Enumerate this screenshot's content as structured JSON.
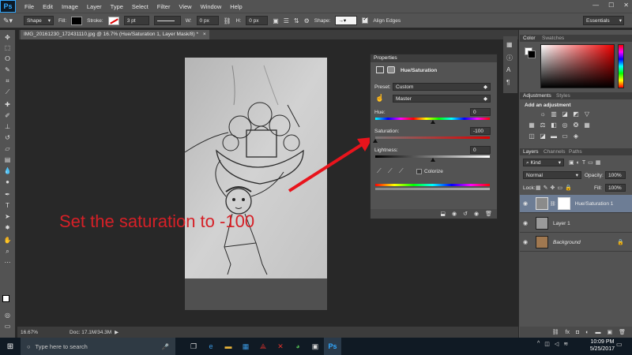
{
  "menubar": {
    "logo": "Ps",
    "items": [
      "File",
      "Edit",
      "Image",
      "Layer",
      "Type",
      "Select",
      "Filter",
      "View",
      "Window",
      "Help"
    ],
    "win_min": "—",
    "win_max": "☐",
    "win_close": "✕"
  },
  "options": {
    "mode": "Shape",
    "fill_label": "Fill:",
    "stroke_label": "Stroke:",
    "stroke_width": "3 pt",
    "w_label": "W:",
    "w_value": "0 px",
    "h_label": "H:",
    "h_value": "0 px",
    "shape_label": "Shape:",
    "align_edges": "Align Edges",
    "workspace": "Essentials"
  },
  "document": {
    "tab_title": "IMG_20161230_172431110.jpg @ 16.7% (Hue/Saturation 1, Layer Mask/8) *",
    "tab_close": "×"
  },
  "status": {
    "zoom": "16.67%",
    "doc_info": "Doc: 17.1M/34.3M"
  },
  "properties": {
    "panel_title": "Properties",
    "adjustment_name": "Hue/Saturation",
    "preset_label": "Preset:",
    "preset_value": "Custom",
    "channel_value": "Master",
    "hue_label": "Hue:",
    "hue_value": "0",
    "hue_level": 0.5,
    "saturation_label": "Saturation:",
    "saturation_value": "-100",
    "saturation_level": 0.0,
    "lightness_label": "Lightness:",
    "lightness_value": "0",
    "lightness_level": 0.5,
    "colorize_label": "Colorize"
  },
  "annotation": {
    "text": "Set the saturation to -100",
    "color": "#d62027"
  },
  "color_panel": {
    "tab1": "Color",
    "tab2": "Swatches"
  },
  "adjustments_panel": {
    "tab1": "Adjustments",
    "tab2": "Styles",
    "heading": "Add an adjustment"
  },
  "layers_panel": {
    "tab1": "Layers",
    "tab2": "Channels",
    "tab3": "Paths",
    "filter_kind": "Kind",
    "blend_mode": "Normal",
    "opacity_label": "Opacity:",
    "opacity_value": "100%",
    "lock_label": "Lock:",
    "fill_label": "Fill:",
    "fill_value": "100%",
    "layers": [
      {
        "name": "Hue/Saturation 1"
      },
      {
        "name": "Layer 1"
      },
      {
        "name": "Background"
      }
    ]
  },
  "taskbar": {
    "search_placeholder": "Type here to search",
    "time": "10:09 PM",
    "date": "5/25/2017"
  }
}
